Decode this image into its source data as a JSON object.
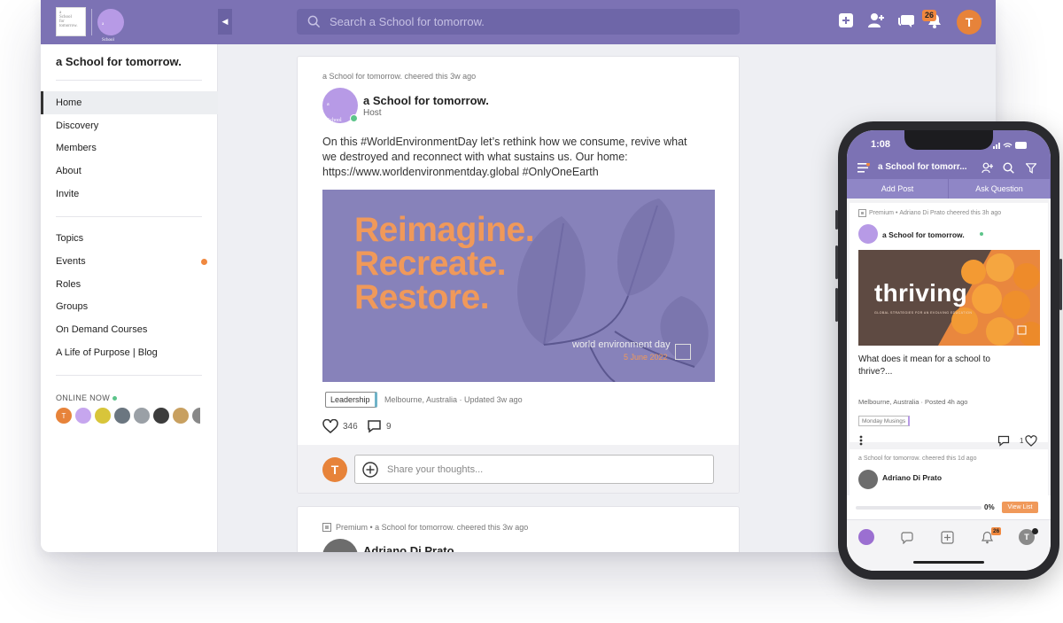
{
  "brand": {
    "logo_square_text": "a\nSchool\nfor\ntomorrow.",
    "logo_circle_text": "a\nSchool\nfor\ntomorrow."
  },
  "header": {
    "search_placeholder": "Search a School for tomorrow.",
    "notification_count": "26",
    "user_initial": "T",
    "accent_color": "#7c72b4"
  },
  "sidebar": {
    "title": "a School for tomorrow.",
    "primary_items": [
      {
        "label": "Home"
      },
      {
        "label": "Discovery"
      },
      {
        "label": "Members"
      },
      {
        "label": "About"
      },
      {
        "label": "Invite"
      }
    ],
    "secondary_items": [
      {
        "label": "Topics"
      },
      {
        "label": "Events"
      },
      {
        "label": "Roles"
      },
      {
        "label": "Groups"
      },
      {
        "label": "On Demand Courses"
      },
      {
        "label": "A Life of Purpose | Blog"
      }
    ],
    "online_label": "ONLINE NOW",
    "online_first_initial": "T"
  },
  "post": {
    "meta": "a School for tomorrow. cheered this 3w ago",
    "author": "a School for tomorrow.",
    "role": "Host",
    "text_line_1": "On this #WorldEnvironmentDay let’s rethink how we consume, revive what",
    "text_line_2": "we destroyed and reconnect with what sustains us. Our home:",
    "text_line_3": "https://www.worldenvironmentday.global #OnlyOneEarth",
    "image_line_1": "Reimagine.",
    "image_line_2": "Recreate.",
    "image_line_3": "Restore.",
    "image_caption": "world environment day",
    "image_date": "5 June 2022",
    "tag": "Leadership",
    "location": "Melbourne, Australia",
    "updated": "Updated 3w ago",
    "likes": "346",
    "comments": "9",
    "comment_placeholder": "Share your thoughts...",
    "commenter_initial": "T"
  },
  "post2": {
    "badge": "Premium",
    "meta": "a School for tomorrow. cheered this 3w ago",
    "author": "Adriano Di Prato"
  },
  "phone": {
    "time": "1:08",
    "title": "a School for tomorr...",
    "add_post": "Add Post",
    "ask_question": "Ask Question",
    "card1": {
      "badge": "Premium",
      "meta": "Adriano Di Prato cheered this 3h ago",
      "author": "a School for tomorrow.",
      "image_word": "thriving",
      "image_sub": "GLOBAL STRATEGIES FOR AN EVOLVING EDUCATION",
      "question_line_1": "What does it mean for a school to",
      "question_line_2": "thrive?...",
      "location": "Melbourne, Australia · Posted 4h ago",
      "tag": "Monday Musings",
      "likes": "1"
    },
    "card2": {
      "meta": "a School for tomorrow. cheered this 1d ago",
      "author": "Adriano Di Prato"
    },
    "progress_value": 0,
    "progress_label": "0%",
    "view_list": "View List",
    "notification_count": "26",
    "user_initial": "T"
  }
}
